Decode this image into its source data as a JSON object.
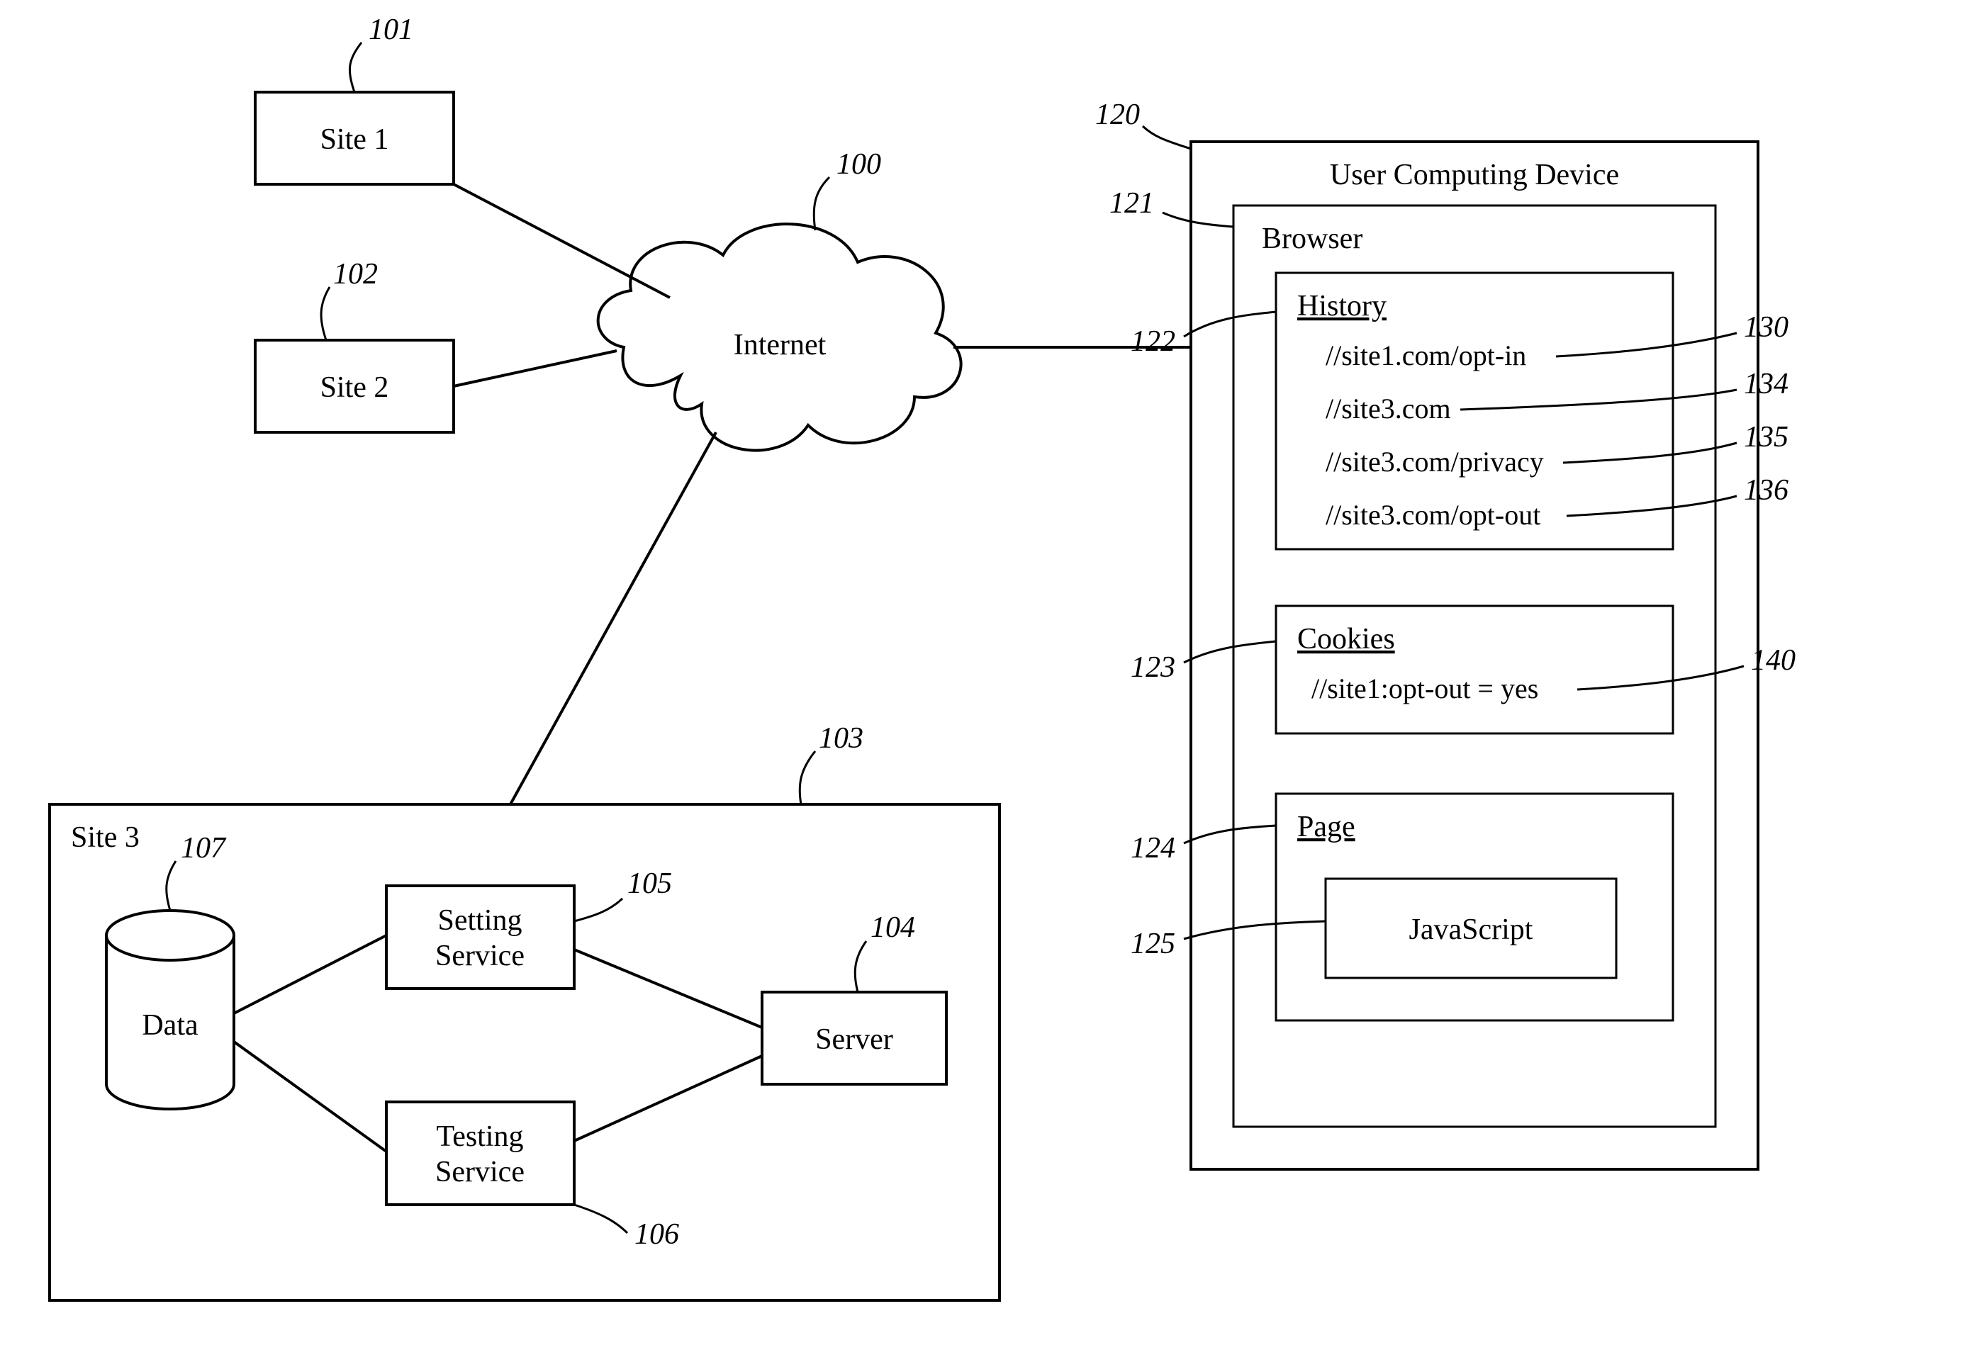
{
  "nodes": {
    "site1": "Site 1",
    "site2": "Site 2",
    "site3": "Site 3",
    "internet": "Internet",
    "setting_service_l1": "Setting",
    "setting_service_l2": "Service",
    "testing_service_l1": "Testing",
    "testing_service_l2": "Service",
    "server": "Server",
    "data": "Data",
    "user_device": "User Computing Device",
    "browser": "Browser",
    "history": "History",
    "history_items": [
      "//site1.com/opt-in",
      "//site3.com",
      "//site3.com/privacy",
      "//site3.com/opt-out"
    ],
    "cookies": "Cookies",
    "cookies_items": [
      "//site1:opt-out = yes"
    ],
    "page": "Page",
    "javascript": "JavaScript"
  },
  "refs": {
    "r100": "100",
    "r101": "101",
    "r102": "102",
    "r103": "103",
    "r104": "104",
    "r105": "105",
    "r106": "106",
    "r107": "107",
    "r120": "120",
    "r121": "121",
    "r122": "122",
    "r123": "123",
    "r124": "124",
    "r125": "125",
    "r130": "130",
    "r134": "134",
    "r135": "135",
    "r136": "136",
    "r140": "140"
  }
}
